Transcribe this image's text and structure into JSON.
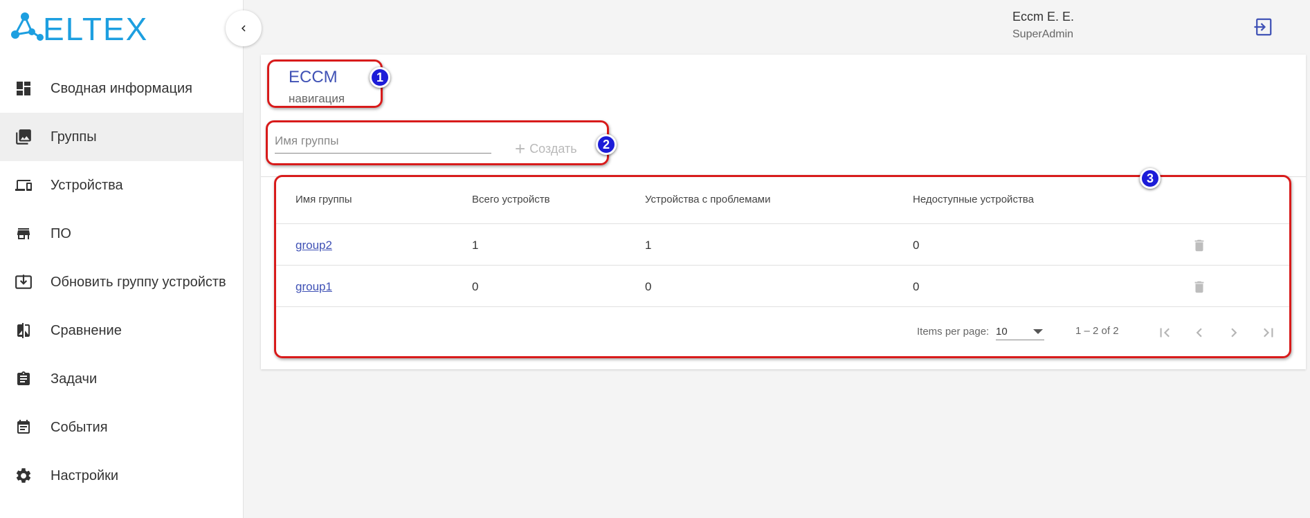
{
  "brand": {
    "logo_text": "ELTEX",
    "accent": "#3f51b5",
    "logo_color": "#1d9fe0"
  },
  "sidebar": {
    "collapse_icon": "chevron-left-icon",
    "items": [
      {
        "label": "Сводная информация",
        "icon": "dashboard-icon",
        "active": false
      },
      {
        "label": "Группы",
        "icon": "photo-library-icon",
        "active": true
      },
      {
        "label": "Устройства",
        "icon": "devices-icon",
        "active": false
      },
      {
        "label": "ПО",
        "icon": "store-icon",
        "active": false
      },
      {
        "label": "Обновить группу устройств",
        "icon": "download-box-icon",
        "active": false
      },
      {
        "label": "Сравнение",
        "icon": "compare-icon",
        "active": false
      },
      {
        "label": "Задачи",
        "icon": "clipboard-icon",
        "active": false
      },
      {
        "label": "События",
        "icon": "event-note-icon",
        "active": false
      },
      {
        "label": "Настройки",
        "icon": "gear-icon",
        "active": false
      }
    ]
  },
  "header": {
    "user_name": "Eccm E. E.",
    "user_role": "SuperAdmin",
    "logout_icon": "logout-icon"
  },
  "page": {
    "title": "ECCM",
    "subtitle": "навигация"
  },
  "create_form": {
    "placeholder": "Имя группы",
    "value": "",
    "create_label": "Создать"
  },
  "table": {
    "columns": [
      "Имя группы",
      "Всего устройств",
      "Устройства с проблемами",
      "Недоступные устройства"
    ],
    "rows": [
      {
        "name": "group2",
        "total": "1",
        "problems": "1",
        "unavailable": "0"
      },
      {
        "name": "group1",
        "total": "0",
        "problems": "0",
        "unavailable": "0"
      }
    ],
    "row_action_icon": "delete-icon"
  },
  "paginator": {
    "items_per_page_label": "Items per page:",
    "page_size": "10",
    "range_label": "1 – 2 of 2",
    "buttons": [
      "first-page-icon",
      "prev-page-icon",
      "next-page-icon",
      "last-page-icon"
    ]
  },
  "annotations": {
    "badges": [
      "1",
      "2",
      "3"
    ],
    "border_color": "#d81b1b",
    "badge_color": "#1c1cd8"
  }
}
